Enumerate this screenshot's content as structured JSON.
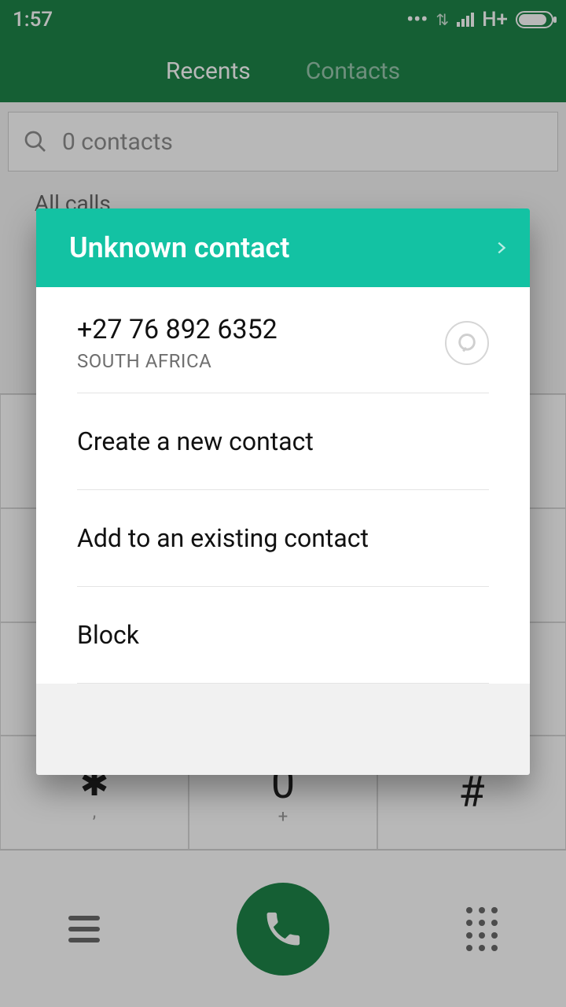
{
  "statusbar": {
    "time": "1:57",
    "network_type": "H+"
  },
  "tabs": {
    "recents": "Recents",
    "contacts": "Contacts"
  },
  "search": {
    "placeholder": "0 contacts"
  },
  "section": {
    "label": "All calls"
  },
  "dialpad": {
    "star": "✱",
    "star_sub": ",",
    "zero": "0",
    "zero_sub": "+",
    "hash": "#"
  },
  "dialog": {
    "title": "Unknown contact",
    "number": "+27 76 892 6352",
    "region": "SOUTH AFRICA",
    "actions": {
      "create": "Create a new contact",
      "add_existing": "Add to an existing contact",
      "block": "Block"
    }
  }
}
